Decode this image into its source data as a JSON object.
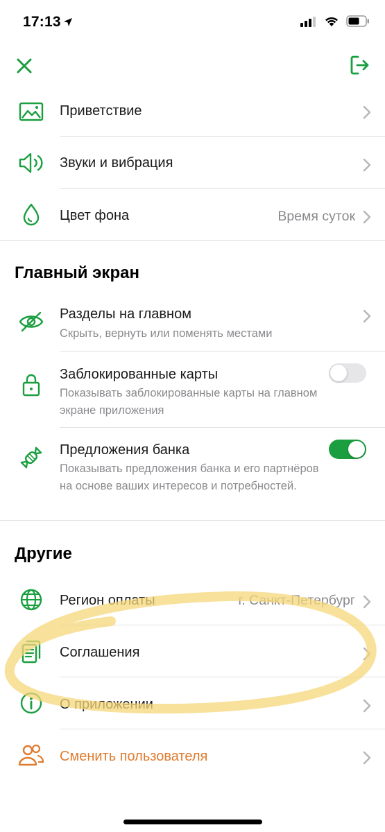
{
  "status_bar": {
    "time": "17:13",
    "location_icon": "location-arrow-icon",
    "signal_icon": "cellular-signal-icon",
    "wifi_icon": "wifi-icon",
    "battery_icon": "battery-icon"
  },
  "top_bar": {
    "close_icon": "close-icon",
    "logout_icon": "logout-icon"
  },
  "settings": [
    {
      "title": "Приветствие",
      "icon": "greeting-image-icon"
    },
    {
      "title": "Звуки и вибрация",
      "icon": "speaker-icon"
    },
    {
      "title": "Цвет фона",
      "value": "Время суток",
      "icon": "drop-icon"
    }
  ],
  "main_screen": {
    "title": "Главный экран",
    "items": [
      {
        "title": "Разделы на главном",
        "subtitle": "Скрыть, вернуть или поменять местами",
        "icon": "eye-crossed-icon"
      },
      {
        "title": "Заблокированные карты",
        "subtitle": "Показывать заблокированные карты на главном экране приложения",
        "toggle": false,
        "icon": "lock-icon"
      },
      {
        "title": "Предложения банка",
        "subtitle": "Показывать предложения банка и его партнёров на основе ваших интересов и потребностей.",
        "toggle": true,
        "icon": "candy-icon"
      }
    ]
  },
  "other": {
    "title": "Другие",
    "items": [
      {
        "title": "Регион оплаты",
        "value": "г. Санкт-Петербург",
        "icon": "globe-icon"
      },
      {
        "title": "Соглашения",
        "icon": "documents-icon"
      },
      {
        "title": "О приложении",
        "icon": "info-icon"
      },
      {
        "title": "Сменить пользователя",
        "icon": "users-icon"
      }
    ]
  },
  "colors": {
    "accent": "#1a9e3f",
    "warning": "#e07b2e",
    "highlight": "#f5d77a",
    "secondary_text": "#8a8a8e"
  }
}
